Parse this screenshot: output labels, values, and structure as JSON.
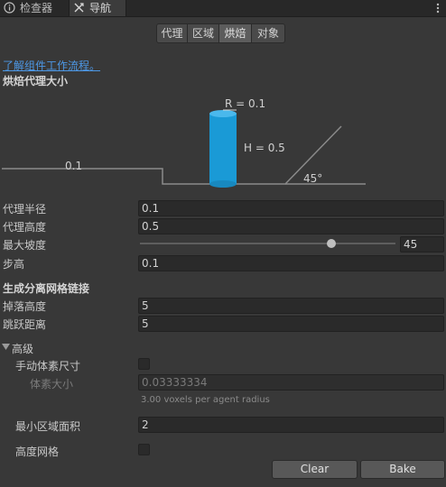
{
  "tabs": [
    {
      "label": "检查器",
      "icon": "info-icon"
    },
    {
      "label": "导航",
      "icon": "navigation-icon"
    }
  ],
  "segments": [
    "代理",
    "区域",
    "烘焙",
    "对象"
  ],
  "active_segment": "烘焙",
  "help_link": "了解组件工作流程。",
  "agent_size_header": "烘焙代理大小",
  "diagram": {
    "radius_label": "R = 0.1",
    "height_label": "H = 0.5",
    "step_label": "0.1",
    "angle_label": "45°"
  },
  "fields": {
    "radius_label": "代理半径",
    "radius_value": "0.1",
    "height_label": "代理高度",
    "height_value": "0.5",
    "slope_label": "最大坡度",
    "slope_value": "45",
    "slope_fraction": 0.75,
    "step_label": "步高",
    "step_value": "0.1"
  },
  "offmesh_header": "生成分离网格链接",
  "offmesh": {
    "drop_label": "掉落高度",
    "drop_value": "5",
    "jump_label": "跳跃距离",
    "jump_value": "5"
  },
  "advanced": {
    "header": "高级",
    "manual_voxel_label": "手动体素尺寸",
    "voxel_size_label": "体素大小",
    "voxel_size_value": "0.03333334",
    "voxel_hint": "3.00 voxels per agent radius",
    "min_region_label": "最小区域面积",
    "min_region_value": "2",
    "height_mesh_label": "高度网格"
  },
  "buttons": {
    "clear": "Clear",
    "bake": "Bake"
  },
  "colors": {
    "accent": "#1a9ad6",
    "link": "#4d98e6",
    "background": "#383838"
  }
}
